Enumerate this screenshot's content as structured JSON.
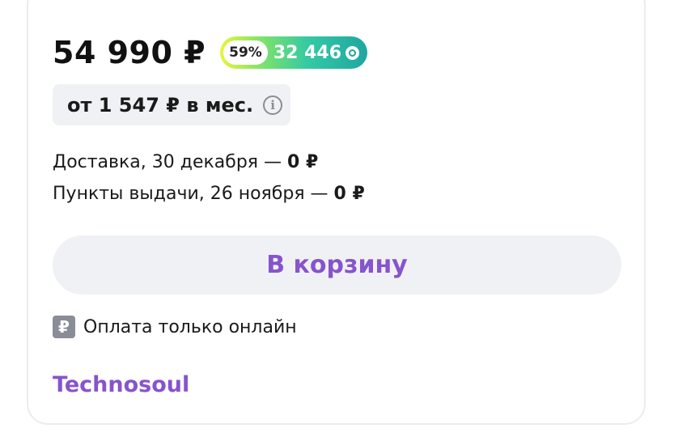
{
  "product": {
    "price": "54 990 ₽",
    "bonus": {
      "percent": "59%",
      "amount": "32 446",
      "icon": "bonus-coin-icon"
    },
    "installment": {
      "text": "от 1 547 ₽ в мес.",
      "icon": "info-icon",
      "icon_glyph": "i"
    }
  },
  "delivery": {
    "courier_label": "Доставка, 30 декабря — ",
    "courier_price": "0 ₽",
    "pickup_label": "Пункты выдачи, 26 ноября — ",
    "pickup_price": "0 ₽"
  },
  "actions": {
    "cart_label": "В корзину"
  },
  "payment": {
    "icon_glyph": "₽",
    "text": "Оплата только онлайн"
  },
  "seller": {
    "name": "Technosoul"
  },
  "colors": {
    "accent": "#8654cc",
    "button_bg": "#f0f1f4",
    "muted_icon": "#8a8d96"
  }
}
